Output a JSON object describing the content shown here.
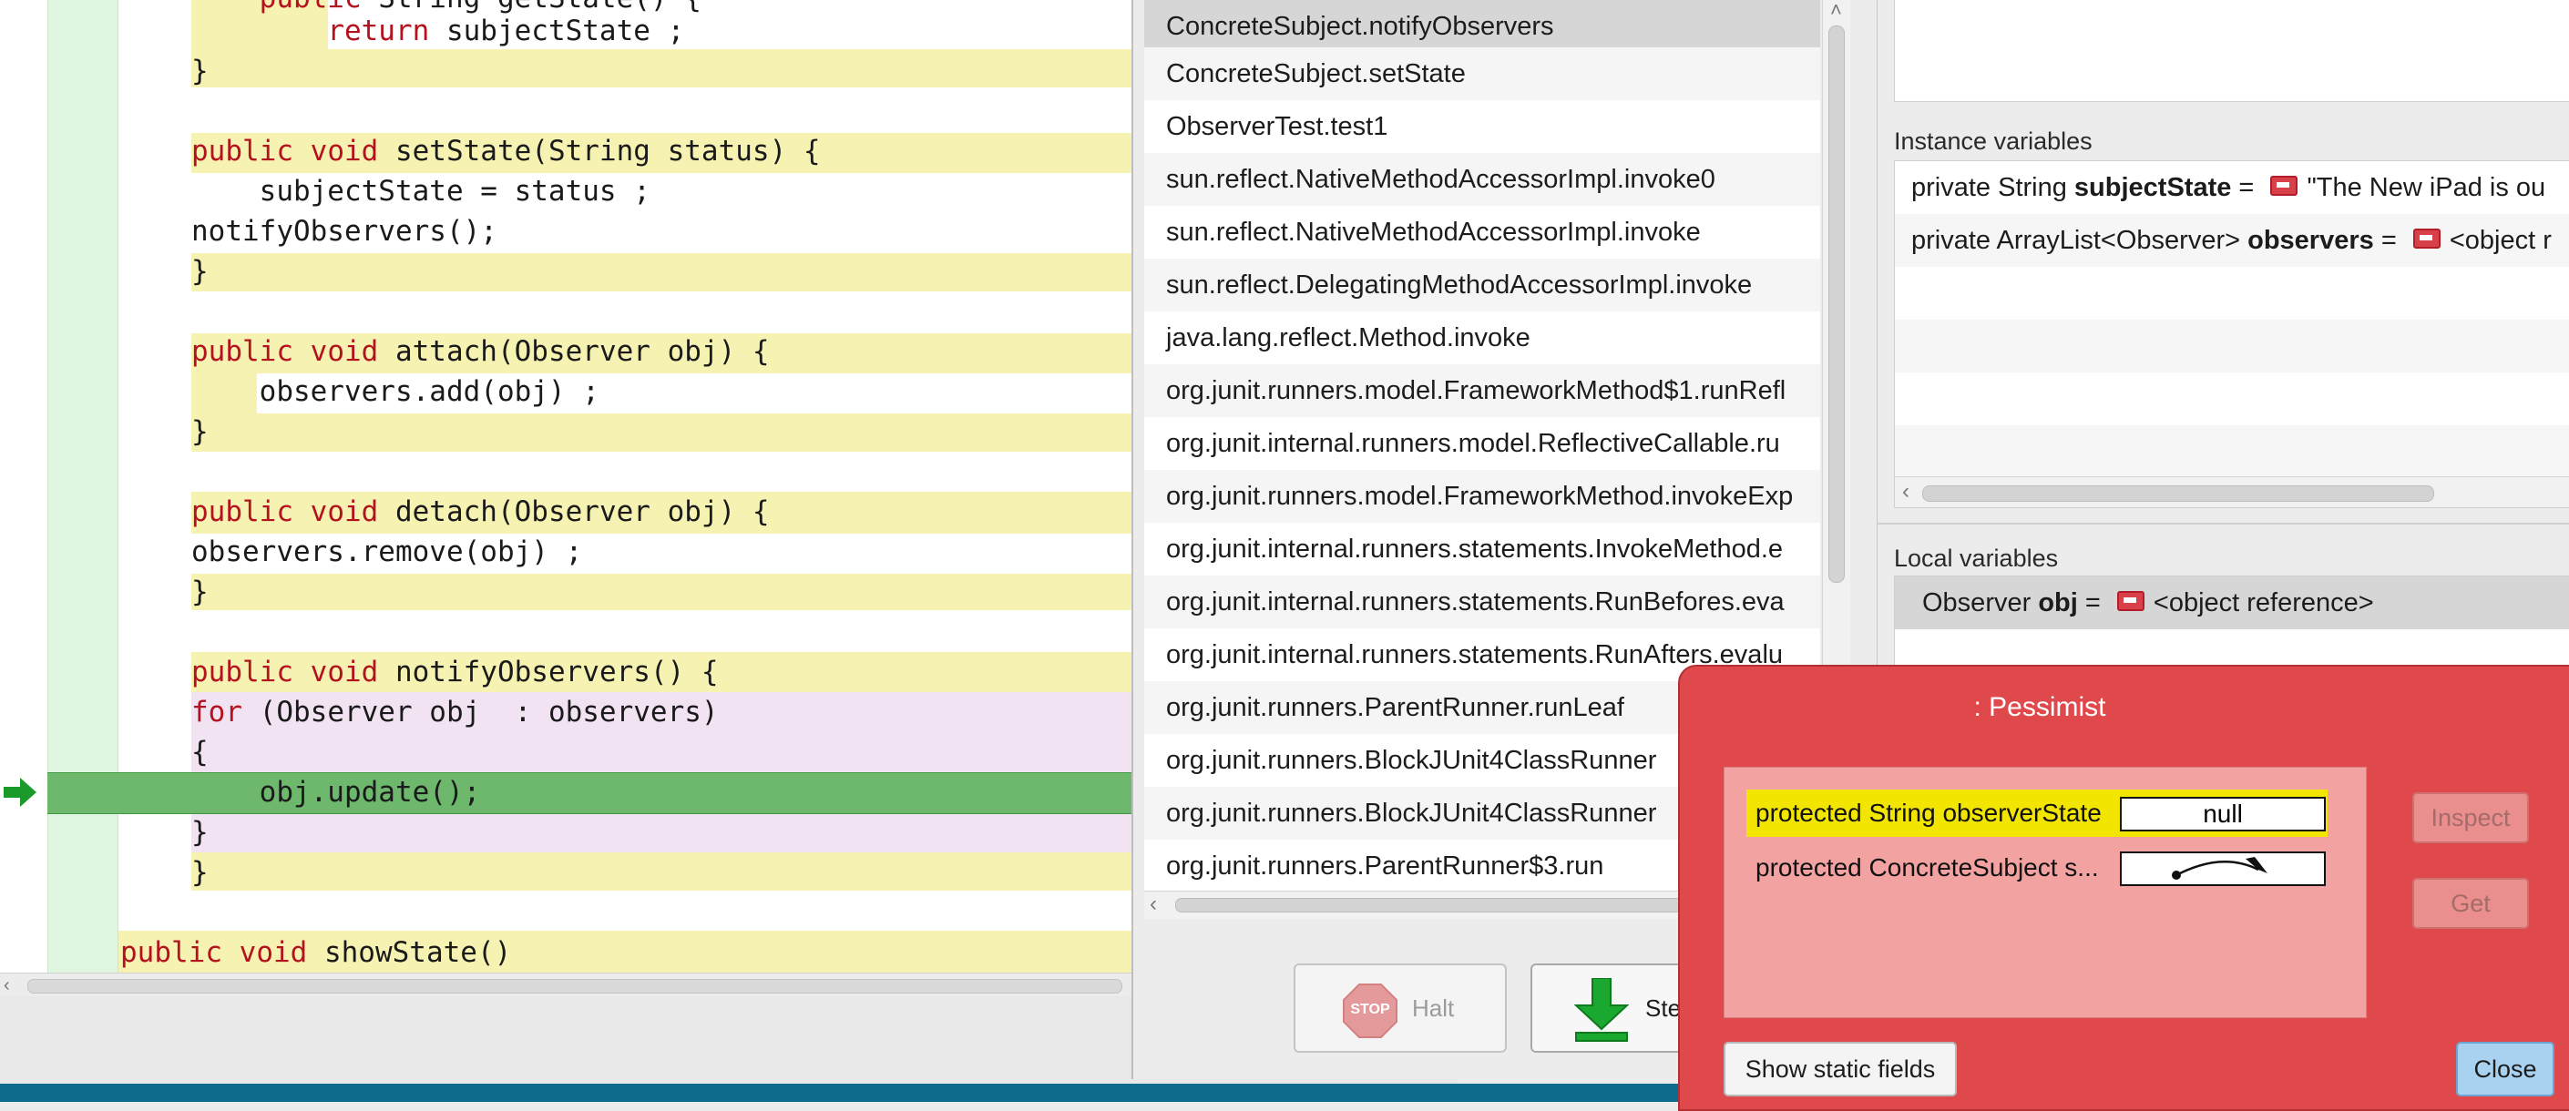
{
  "editor": {
    "lines": [
      {
        "indent": "    ",
        "kw": "public",
        "rest": " String getState() {"
      },
      {
        "indent": "        ",
        "kw": "return",
        "rest": " subjectState ;"
      },
      {
        "indent": "",
        "kw": "",
        "rest": "}"
      },
      {
        "indent": "",
        "kw": "public",
        "kw2": "void",
        "rest": " setState(String status) {"
      },
      {
        "indent": "    ",
        "kw": "",
        "rest": "subjectState = status ;"
      },
      {
        "indent": "",
        "kw": "",
        "rest": "notifyObservers();"
      },
      {
        "indent": "",
        "kw": "",
        "rest": "}"
      },
      {
        "indent": "",
        "kw": "public",
        "kw2": "void",
        "rest": " attach(Observer obj) {"
      },
      {
        "indent": "    ",
        "kw": "",
        "rest": "observers.add(obj) ;"
      },
      {
        "indent": "",
        "kw": "",
        "rest": "}"
      },
      {
        "indent": "",
        "kw": "public",
        "kw2": "void",
        "rest": " detach(Observer obj) {"
      },
      {
        "indent": "",
        "kw": "",
        "rest": "observers.remove(obj) ;"
      },
      {
        "indent": "",
        "kw": "",
        "rest": "}"
      },
      {
        "indent": "",
        "kw": "public",
        "kw2": "void",
        "rest": " notifyObservers() {"
      },
      {
        "indent": "",
        "kw": "for",
        "rest": " (Observer obj  : observers)"
      },
      {
        "indent": "",
        "kw": "",
        "rest": "{"
      },
      {
        "indent": "    ",
        "kw": "",
        "rest": "obj.update();"
      },
      {
        "indent": "",
        "kw": "",
        "rest": "}"
      },
      {
        "indent": "",
        "kw": "",
        "rest": "}"
      },
      {
        "indent": "",
        "kw": "public",
        "kw2": "void",
        "rest": " showState()"
      }
    ],
    "current_line_arrow_color": "#1a9a2a"
  },
  "call_stack": [
    "ConcreteSubject.notifyObservers",
    "ConcreteSubject.setState",
    "ObserverTest.test1",
    "sun.reflect.NativeMethodAccessorImpl.invoke0",
    "sun.reflect.NativeMethodAccessorImpl.invoke",
    "sun.reflect.DelegatingMethodAccessorImpl.invoke",
    "java.lang.reflect.Method.invoke",
    "org.junit.runners.model.FrameworkMethod$1.runRefl",
    "org.junit.internal.runners.model.ReflectiveCallable.ru",
    "org.junit.runners.model.FrameworkMethod.invokeExp",
    "org.junit.internal.runners.statements.InvokeMethod.e",
    "org.junit.internal.runners.statements.RunBefores.eva",
    "org.junit.internal.runners.statements.RunAfters.evalu",
    "org.junit.runners.ParentRunner.runLeaf",
    "org.junit.runners.BlockJUnit4ClassRunner",
    "org.junit.runners.BlockJUnit4ClassRunner",
    "org.junit.runners.ParentRunner$3.run"
  ],
  "controls": {
    "halt_label": "Halt",
    "halt_icon_text": "STOP",
    "step_label": "Ste"
  },
  "instance_vars": {
    "label": "Instance variables",
    "rows": [
      {
        "prefix": "private  String ",
        "name": "subjectState",
        "eq": " = ",
        "value": "\"The New iPad is ou"
      },
      {
        "prefix": "private  ArrayList<Observer> ",
        "name": "observers",
        "eq": " = ",
        "value": "<object r"
      }
    ]
  },
  "local_vars": {
    "label": "Local variables",
    "rows": [
      {
        "prefix": "Observer ",
        "name": "obj",
        "eq": " = ",
        "value": "<object reference>"
      }
    ]
  },
  "inspector": {
    "title": ": Pessimist",
    "fields": [
      {
        "label": "protected String observerState",
        "value": "null"
      },
      {
        "label": "protected ConcreteSubject s...",
        "value": ""
      }
    ],
    "inspect_label": "Inspect",
    "get_label": "Get",
    "show_static_label": "Show static fields",
    "close_label": "Close",
    "colors": {
      "dialog_bg": "#e0494c",
      "selected_field": "#f2e600",
      "close_button": "#a9d2f0"
    }
  }
}
